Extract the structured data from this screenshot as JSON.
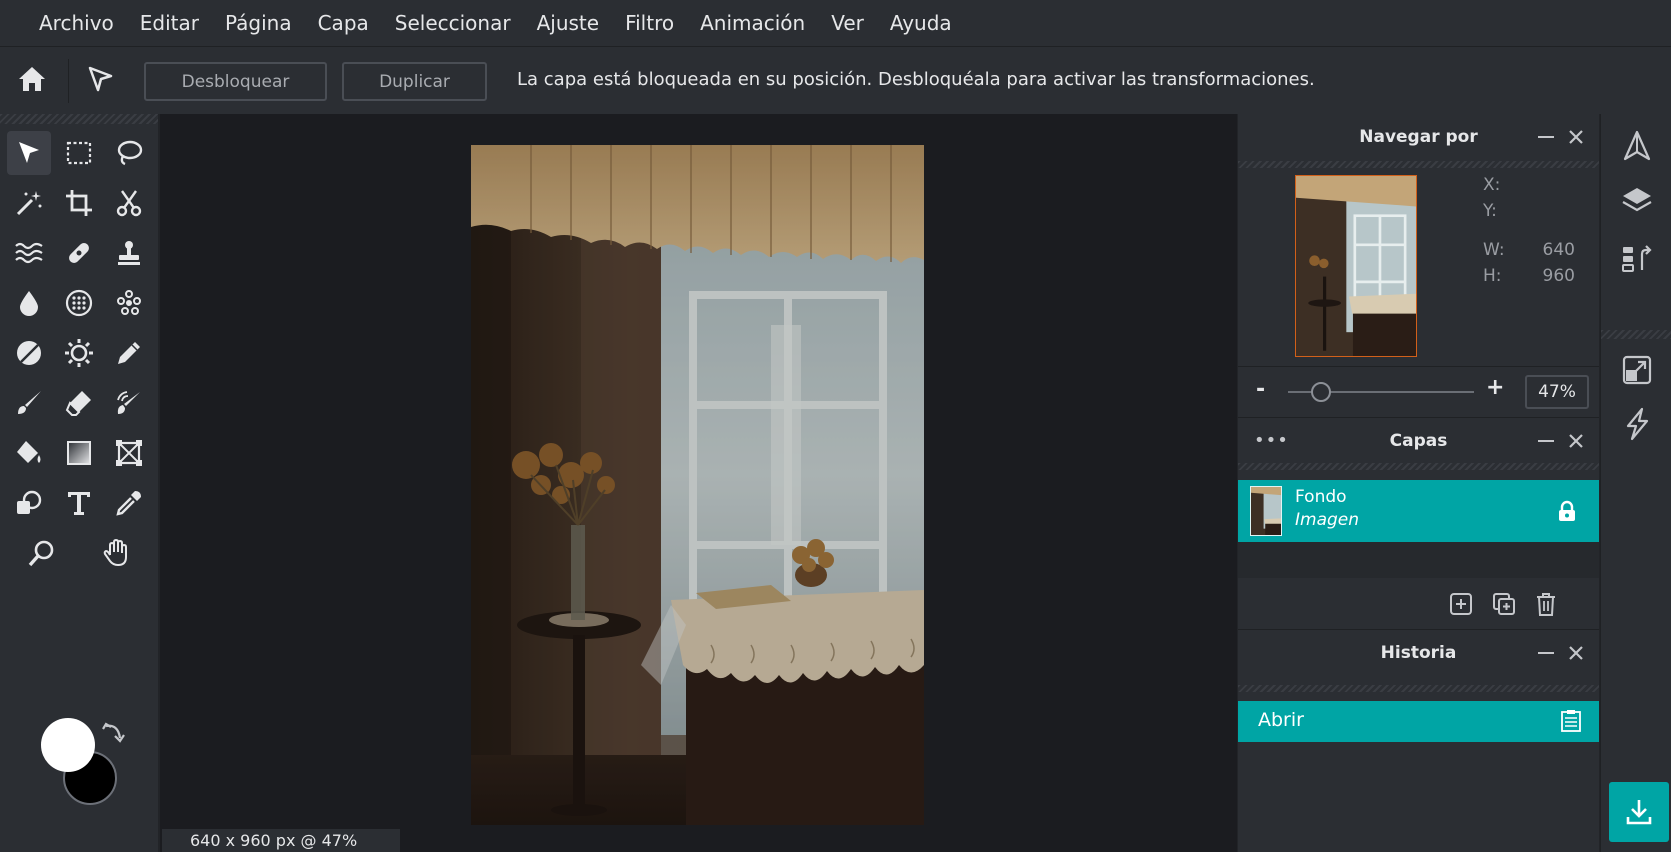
{
  "menu": [
    "Archivo",
    "Editar",
    "Página",
    "Capa",
    "Seleccionar",
    "Ajuste",
    "Filtro",
    "Animación",
    "Ver",
    "Ayuda"
  ],
  "options": {
    "unlock_label": "Desbloquear",
    "duplicate_label": "Duplicar",
    "message": "La capa está bloqueada en su posición. Desbloquéala para activar las transformaciones."
  },
  "status": "640 x 960 px @ 47%",
  "navigator": {
    "title": "Navegar por",
    "x_label": "X:",
    "y_label": "Y:",
    "w_label": "W:",
    "h_label": "H:",
    "w_value": "640",
    "h_value": "960",
    "zoom_minus": "-",
    "zoom_plus": "+",
    "zoom_value": "47%",
    "zoom_level": 0.18
  },
  "layers": {
    "title": "Capas",
    "dots": "•••",
    "items": [
      {
        "name": "Fondo",
        "type": "Imagen",
        "locked": true
      }
    ]
  },
  "history": {
    "title": "Historia",
    "items": [
      {
        "label": "Abrir"
      }
    ]
  },
  "colors": {
    "accent": "#00a5a5",
    "foreground_swatch": "#ffffff",
    "background_swatch": "#000000",
    "thumb_border": "#d2601a"
  },
  "tools": [
    "move-tool",
    "marquee-select-tool",
    "lasso-tool",
    "magic-wand-tool",
    "crop-tool",
    "cut-tool",
    "liquify-tool",
    "healing-brush-tool",
    "clone-stamp-tool",
    "blur-tool",
    "sponge-tool",
    "pixelate-tool",
    "dodge-burn-tool",
    "sharpen-tool",
    "color-picker-pencil-tool",
    "brush-tool",
    "eraser-tool",
    "smudge-tool",
    "paint-bucket-tool",
    "gradient-tool",
    "frame-tool",
    "shape-tool",
    "text-tool",
    "eyedropper-tool",
    "zoom-tool",
    "hand-tool"
  ]
}
